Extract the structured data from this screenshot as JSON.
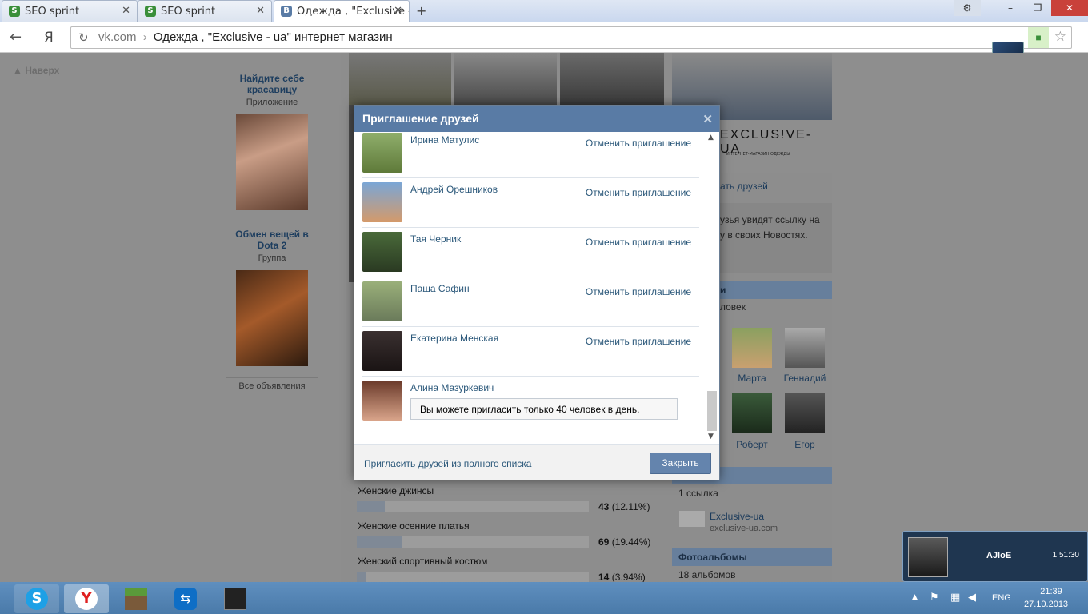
{
  "browser": {
    "tabs": [
      {
        "title": "SEO sprint",
        "icon": "seo-sprint-icon",
        "active": false
      },
      {
        "title": "SEO sprint",
        "icon": "seo-sprint-icon",
        "active": false
      },
      {
        "title": "Одежда , \"Exclusive - u",
        "icon": "vk-icon",
        "active": true
      }
    ],
    "new_tab_glyph": "+",
    "address": {
      "domain": "vk.com",
      "separator": "›",
      "page_title": "Одежда , \"Exclusive - ua\" интернет магазин"
    },
    "yandex_glyph": "Я"
  },
  "page": {
    "back_to_top": "Наверх",
    "ads": [
      {
        "title": "Найдите себе красавицу",
        "subtitle": "Приложение"
      },
      {
        "title": "Обмен вещей в Dota 2",
        "subtitle": "Группа"
      }
    ],
    "all_ads": "Все объявления",
    "shop_logo": "EXCLUS!VE-UA",
    "shop_tagline": "ИНТЕРНЕТ-МАГАЗИН ОДЕЖДЫ",
    "tell_friends": "ать друзей",
    "news_hint_1": "узья увидят ссылку на",
    "news_hint_2": "у в своих Новостях.",
    "members_head": "и",
    "members_count": "ловек",
    "friends": [
      {
        "name": "Марта"
      },
      {
        "name": "Геннадий"
      },
      {
        "name": "Роберт"
      },
      {
        "name": "Егор"
      }
    ],
    "links_head": "",
    "links_count": "1 ссылка",
    "link_title": "Exclusive-ua",
    "link_url": "exclusive-ua.com",
    "albums_head": "Фотоальбомы",
    "albums_count": "18 альбомов",
    "poll": [
      {
        "name": "Женские джинсы",
        "count": "43",
        "pct": "(12.11%)",
        "fraction": 0.1211
      },
      {
        "name": "Женские осенние платья",
        "count": "69",
        "pct": "(19.44%)",
        "fraction": 0.1944
      },
      {
        "name": "Женский спортивный костюм",
        "count": "14",
        "pct": "(3.94%)",
        "fraction": 0.0394
      }
    ]
  },
  "modal": {
    "title": "Приглашение друзей",
    "rows": [
      {
        "name": "Ирина Матулис",
        "action": "Отменить приглашение"
      },
      {
        "name": "Андрей Орешников",
        "action": "Отменить приглашение"
      },
      {
        "name": "Тая Черник",
        "action": "Отменить приглашение"
      },
      {
        "name": "Паша Сафин",
        "action": "Отменить приглашение"
      },
      {
        "name": "Екатерина Менская",
        "action": "Отменить приглашение"
      },
      {
        "name": "Алина Мазуркевич",
        "action": ""
      }
    ],
    "limit_message": "Вы можете пригласить только 40 человек в день.",
    "full_list_link": "Пригласить друзей из полного списка",
    "close_button": "Закрыть"
  },
  "notification": {
    "name": "AJIoE",
    "time": "1:51:30"
  },
  "taskbar": {
    "apps": [
      "skype-icon",
      "yandex-browser-icon",
      "minecraft-icon",
      "teamviewer-icon",
      "app-icon"
    ],
    "lang": "ENG",
    "time": "21:39",
    "date": "27.10.2013"
  }
}
